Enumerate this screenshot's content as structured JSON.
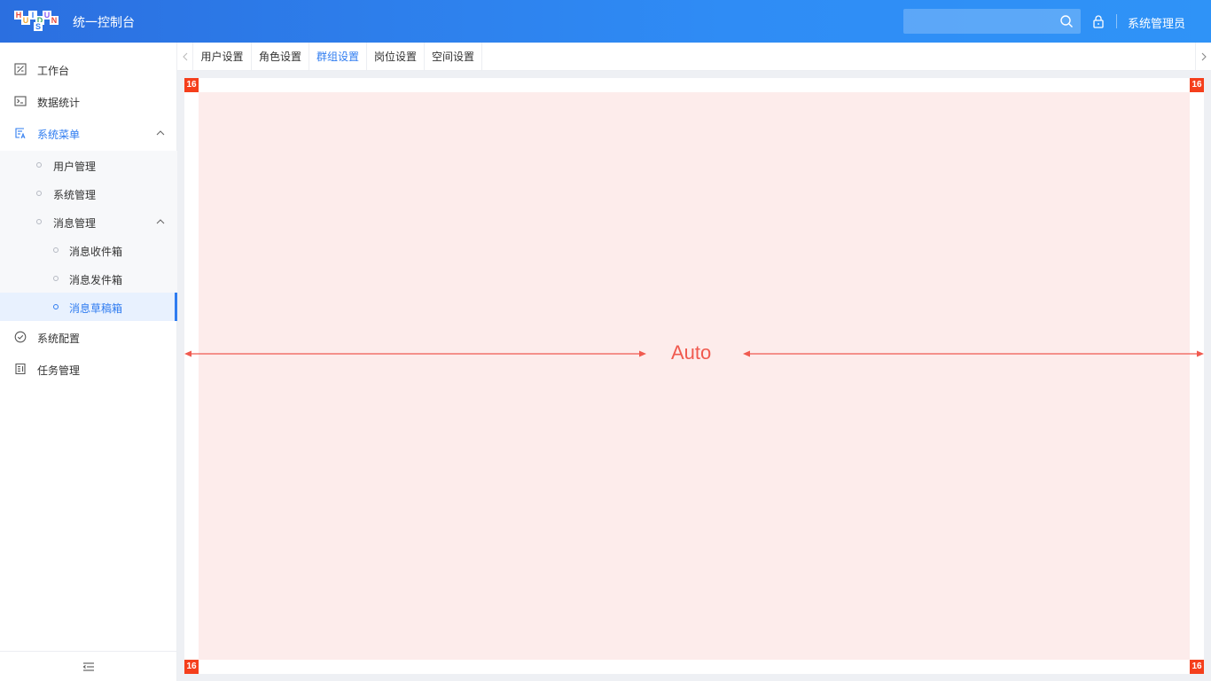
{
  "header": {
    "logo_letters": [
      "H",
      "U",
      "I",
      "D",
      "U",
      "N",
      "S"
    ],
    "app_title": "统一控制台",
    "search": {
      "placeholder": "",
      "value": ""
    },
    "user_name": "系统管理员",
    "colors": {
      "header_start": "#2b6fe0",
      "header_end": "#2f93f7",
      "accent": "#2f7cf0"
    }
  },
  "sidebar": {
    "items": [
      {
        "label": "工作台",
        "icon": "workbench-icon"
      },
      {
        "label": "数据统计",
        "icon": "terminal-icon"
      },
      {
        "label": "系统菜单",
        "icon": "menu-list-icon",
        "expanded": true,
        "children": [
          {
            "label": "用户管理"
          },
          {
            "label": "系统管理"
          },
          {
            "label": "消息管理",
            "expanded": true,
            "children": [
              {
                "label": "消息收件箱"
              },
              {
                "label": "消息发件箱"
              },
              {
                "label": "消息草稿箱",
                "active": true
              }
            ]
          }
        ]
      },
      {
        "label": "系统配置",
        "icon": "check-circle-icon"
      },
      {
        "label": "任务管理",
        "icon": "task-icon"
      }
    ]
  },
  "tabs": [
    {
      "label": "用户设置"
    },
    {
      "label": "角色设置"
    },
    {
      "label": "群组设置",
      "active": true
    },
    {
      "label": "岗位设置"
    },
    {
      "label": "空间设置"
    }
  ],
  "content": {
    "padding_badge": "16",
    "width_label": "Auto",
    "colors": {
      "inner_bg": "#fdeceb",
      "annotation": "#f05a4f",
      "badge": "#f53f1c"
    }
  }
}
